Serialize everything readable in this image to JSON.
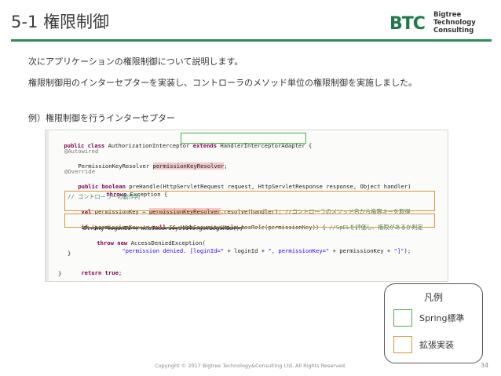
{
  "slide": {
    "title": "5-1 権限制御",
    "logo": {
      "mark": "BTC",
      "line1": "Bigtree",
      "line2": "Technology",
      "line3": "Consulting"
    },
    "intro": "次にアプリケーションの権限制御について説明します。",
    "description": "権限制御用のインターセプターを実装し、コントローラのメソッド単位の権限制御を実施しました。",
    "example_caption": "例）権限制御を行うインターセプター",
    "code": {
      "l1_kw1": "public class",
      "l1_name": " AuthorizationInterceptor ",
      "l1_kw2": "extends",
      "l1_parent": " HandlerInterceptorAdapter",
      "l1_end": " {",
      "l2": "@Autowired",
      "l3_type": "PermissionKeyResolver ",
      "l3_field": "permissionKeyResolver",
      "l3_end": ";",
      "l4": "@Override",
      "l5_kw": "public boolean",
      "l5_rest": " preHandle(HttpServletRequest request, HttpServletResponse response, Object handler)",
      "l6_kw": "throws",
      "l6_rest": " Exception {",
      "l7": "// コントローラーの動作判",
      "l8_kw": "val",
      "l8_a": " permissionKey = ",
      "l8_b": "permissionKeyResolver",
      "l8_c": ".resolve(handler);",
      "l8_cm": " //コントローラのメソッド名から権限キーを取得",
      "l9_kw": "if",
      "l9_a": " (permissionKey != ",
      "l9_null": "null",
      "l9_b": " && !WebSecurityUtils.",
      "l9_method": "hasRole",
      "l9_c": "(permissionKey)) {",
      "l9_cm": " //SpELを評価し、権限があるか判定",
      "l10": "String loginId = WebSecurityUtils.getLoginId();",
      "l11_kw": "throw new",
      "l11_rest": " AccessDeniedException(",
      "l12_str1": "\"permission denied. [loginId=\"",
      "l12_a": " + loginId + ",
      "l12_str2": "\", permissionKey=\"",
      "l12_b": " + permissionKey + ",
      "l12_str3": "\"]\"",
      "l12_end": ");",
      "l13": "}",
      "l14_kw": "return true",
      "l14_end": ";",
      "l15": "}"
    },
    "legend": {
      "title": "凡例",
      "items": [
        {
          "label": "Spring標準",
          "color": "#4caf50"
        },
        {
          "label": "拡張実装",
          "color": "#d9953a"
        }
      ]
    },
    "footer": "Copyright © 2017 Bigtree Technology&Consulting Ltd. All Rights Reserved.",
    "page_number": "34"
  }
}
